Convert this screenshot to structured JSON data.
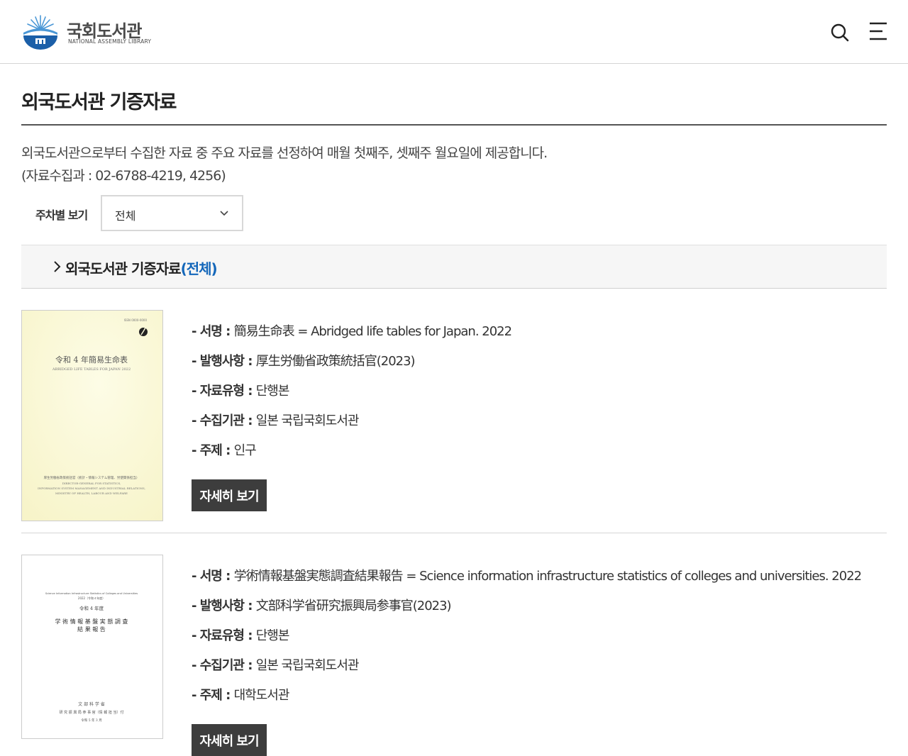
{
  "header": {
    "logo_ko": "국회도서관",
    "logo_en": "NATIONAL ASSEMBLY LIBRARY",
    "search_icon": "search-icon",
    "menu_icon": "hamburger-menu-icon"
  },
  "page": {
    "title": "외국도서관 기증자료",
    "description_line1": "외국도서관으로부터 수집한 자료 중 주요 자료를 선정하여 매월 첫째주, 셋째주 월요일에 제공합니다.",
    "description_line2": "(자료수집과 : 02-6788-4219, 4256)"
  },
  "filter": {
    "label": "주차별 보기",
    "selected": "전체"
  },
  "section": {
    "title": "외국도서관 기증자료",
    "highlight": "(전체)"
  },
  "items": [
    {
      "title_label": "- 서명 : ",
      "title": "簡易生命表 = Abridged life tables for Japan. 2022",
      "publisher_label": "- 발행사항 : ",
      "publisher": "厚生労働省政策統括官(2023)",
      "type_label": "- 자료유형 : ",
      "type": "단행본",
      "org_label": "- 수집기관 : ",
      "org": "일본 국립국회도서관",
      "subject_label": "- 주제 : ",
      "subject": "인구",
      "button": "자세히 보기",
      "cover": {
        "title": "令和 4 年簡易生命表",
        "subtitle": "ABRIDGED LIFE TABLES FOR JAPAN 2022",
        "issn": "ISSN 0000-0000",
        "footer1": "厚生労働省政策統括官（統計・情報システム管理、労使関係担当）",
        "footer2": "DIRECTOR-GENERAL FOR STATISTICS,",
        "footer3": "INFORMATION SYSTEM MANAGEMENT AND INDUSTRIAL RELATIONS,",
        "footer4": "MINISTRY OF HEALTH, LABOUR AND WELFARE",
        "bg_color": "#fbf9dc"
      }
    },
    {
      "title_label": "- 서명 : ",
      "title": "学術情報基盤実態調査結果報告 = Science information infrastructure statistics of colleges and universities. 2022",
      "publisher_label": "- 발행사항 : ",
      "publisher": "文部科学省研究振興局参事官(2023)",
      "type_label": "- 자료유형 : ",
      "type": "단행본",
      "org_label": "- 수집기관 : ",
      "org": "일본 국립국회도서관",
      "subject_label": "- 주제 : ",
      "subject": "대학도서관",
      "button": "자세히 보기",
      "cover": {
        "eng_title": "Science Information Infrastructure Statistics of Colleges and Universities",
        "year": "2022（令和４年度）",
        "era": "令和 4 年度",
        "title1": "学 術 情 報 基 盤 実 態 調 査",
        "title2": "結 果 報 告",
        "publisher1": "文 部 科 学 省",
        "publisher2": "研 究 振 興 局 参 事 官（情 報 担 当）付",
        "date": "令和 5 年 3 月",
        "bg_color": "#ffffff"
      }
    }
  ],
  "colors": {
    "accent": "#1467ba",
    "button_bg": "#3d3d3d",
    "logo_blue": "#1b5fa8"
  }
}
